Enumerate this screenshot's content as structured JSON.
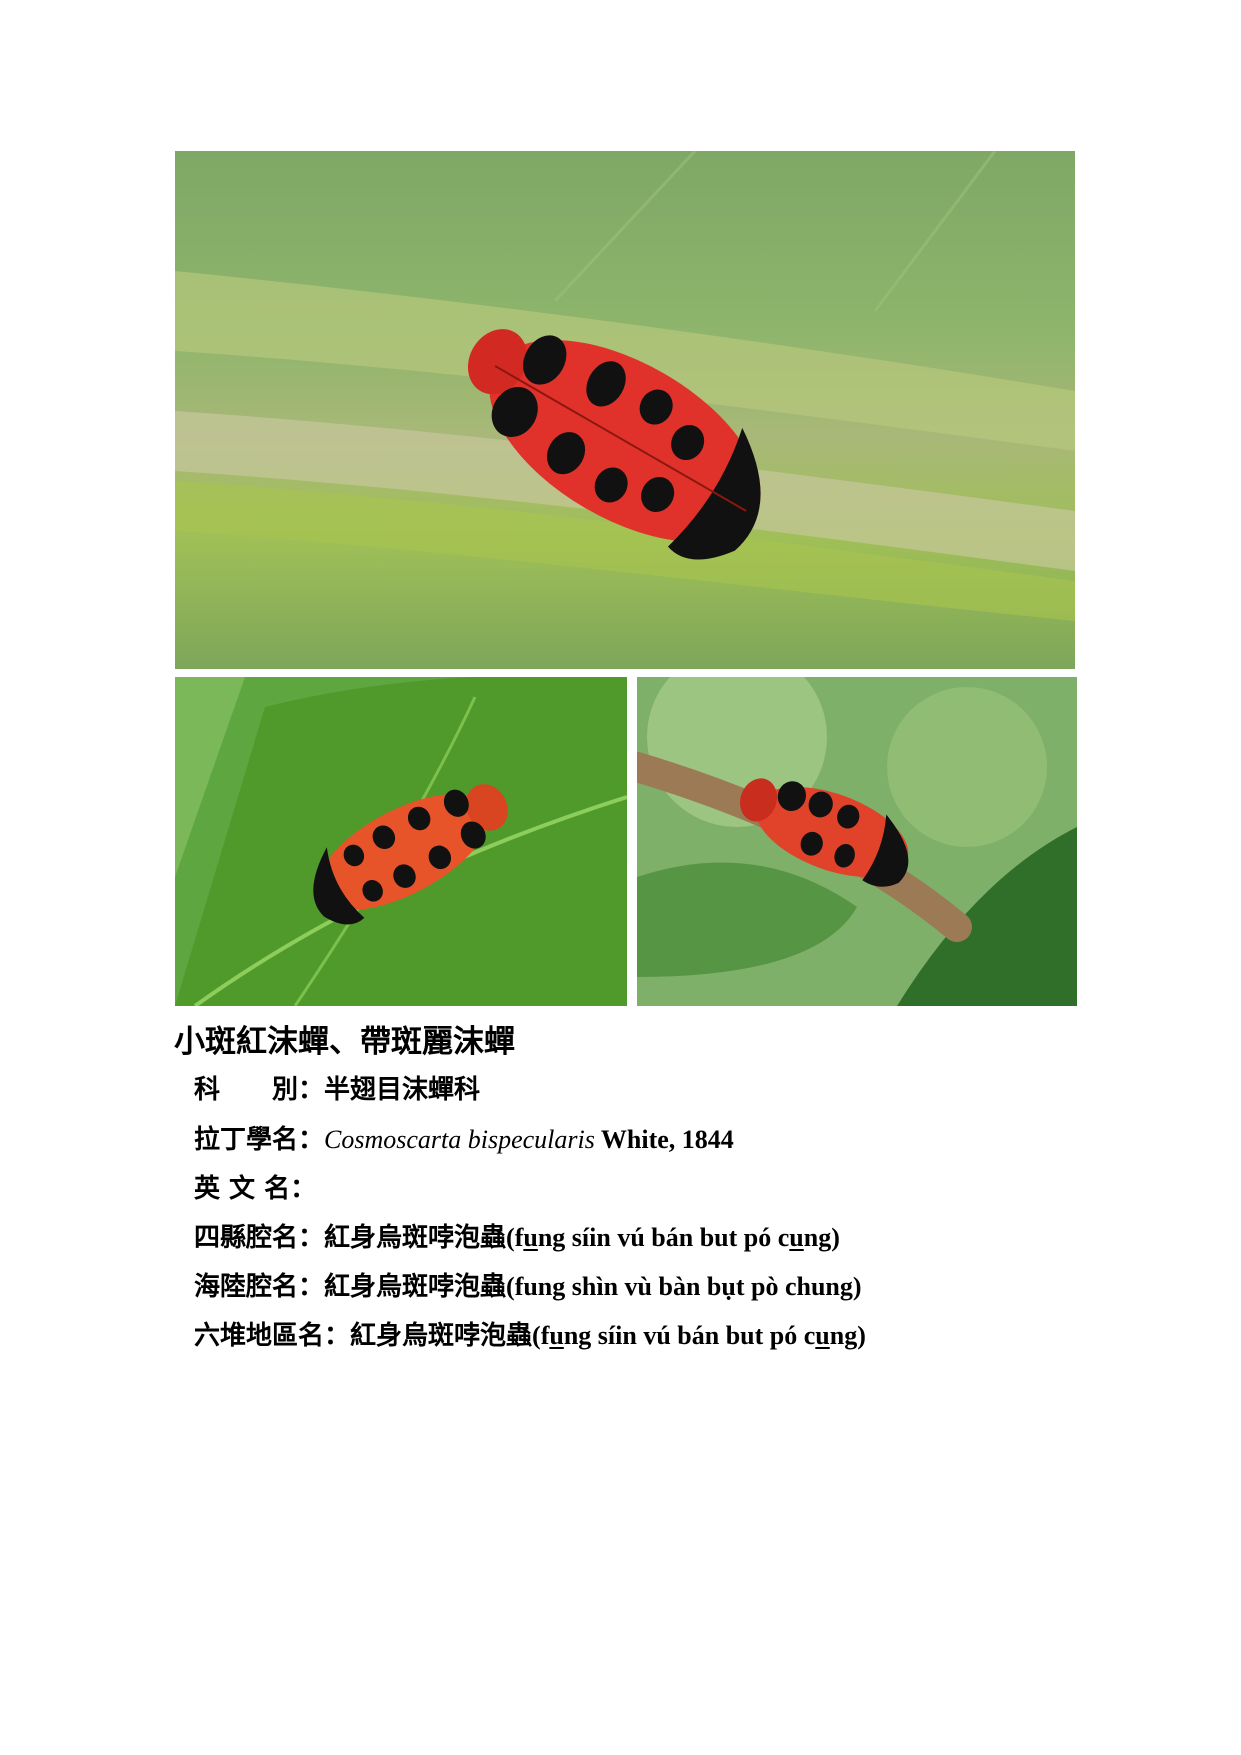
{
  "title": "小斑紅沫蟬、帶斑麗沫蟬",
  "rows": [
    {
      "label": "科　　別：",
      "value": "半翅目沫蟬科"
    },
    {
      "label": "拉丁學名：",
      "sci": "Cosmoscarta bispecularis",
      "author": " White, 1844"
    },
    {
      "label": "英 文 名：",
      "value": ""
    },
    {
      "label": "四縣腔名：",
      "cjk": "紅身烏斑哱泡蟲",
      "pre": "(f",
      "u1": "u",
      "mid": "ng síin vú bán but pó c",
      "u2": "u",
      "post": "ng)"
    },
    {
      "label": "海陸腔名：",
      "cjk": "紅身烏斑哱泡蟲",
      "roman": "(fung shìn vù bàn bụt pò chung)"
    },
    {
      "label": "六堆地區名：",
      "cjk": "紅身烏斑哱泡蟲",
      "pre": "(f",
      "u1": "u",
      "mid": "ng síin vú bán but pó c",
      "u2": "u",
      "post": "ng)"
    }
  ]
}
